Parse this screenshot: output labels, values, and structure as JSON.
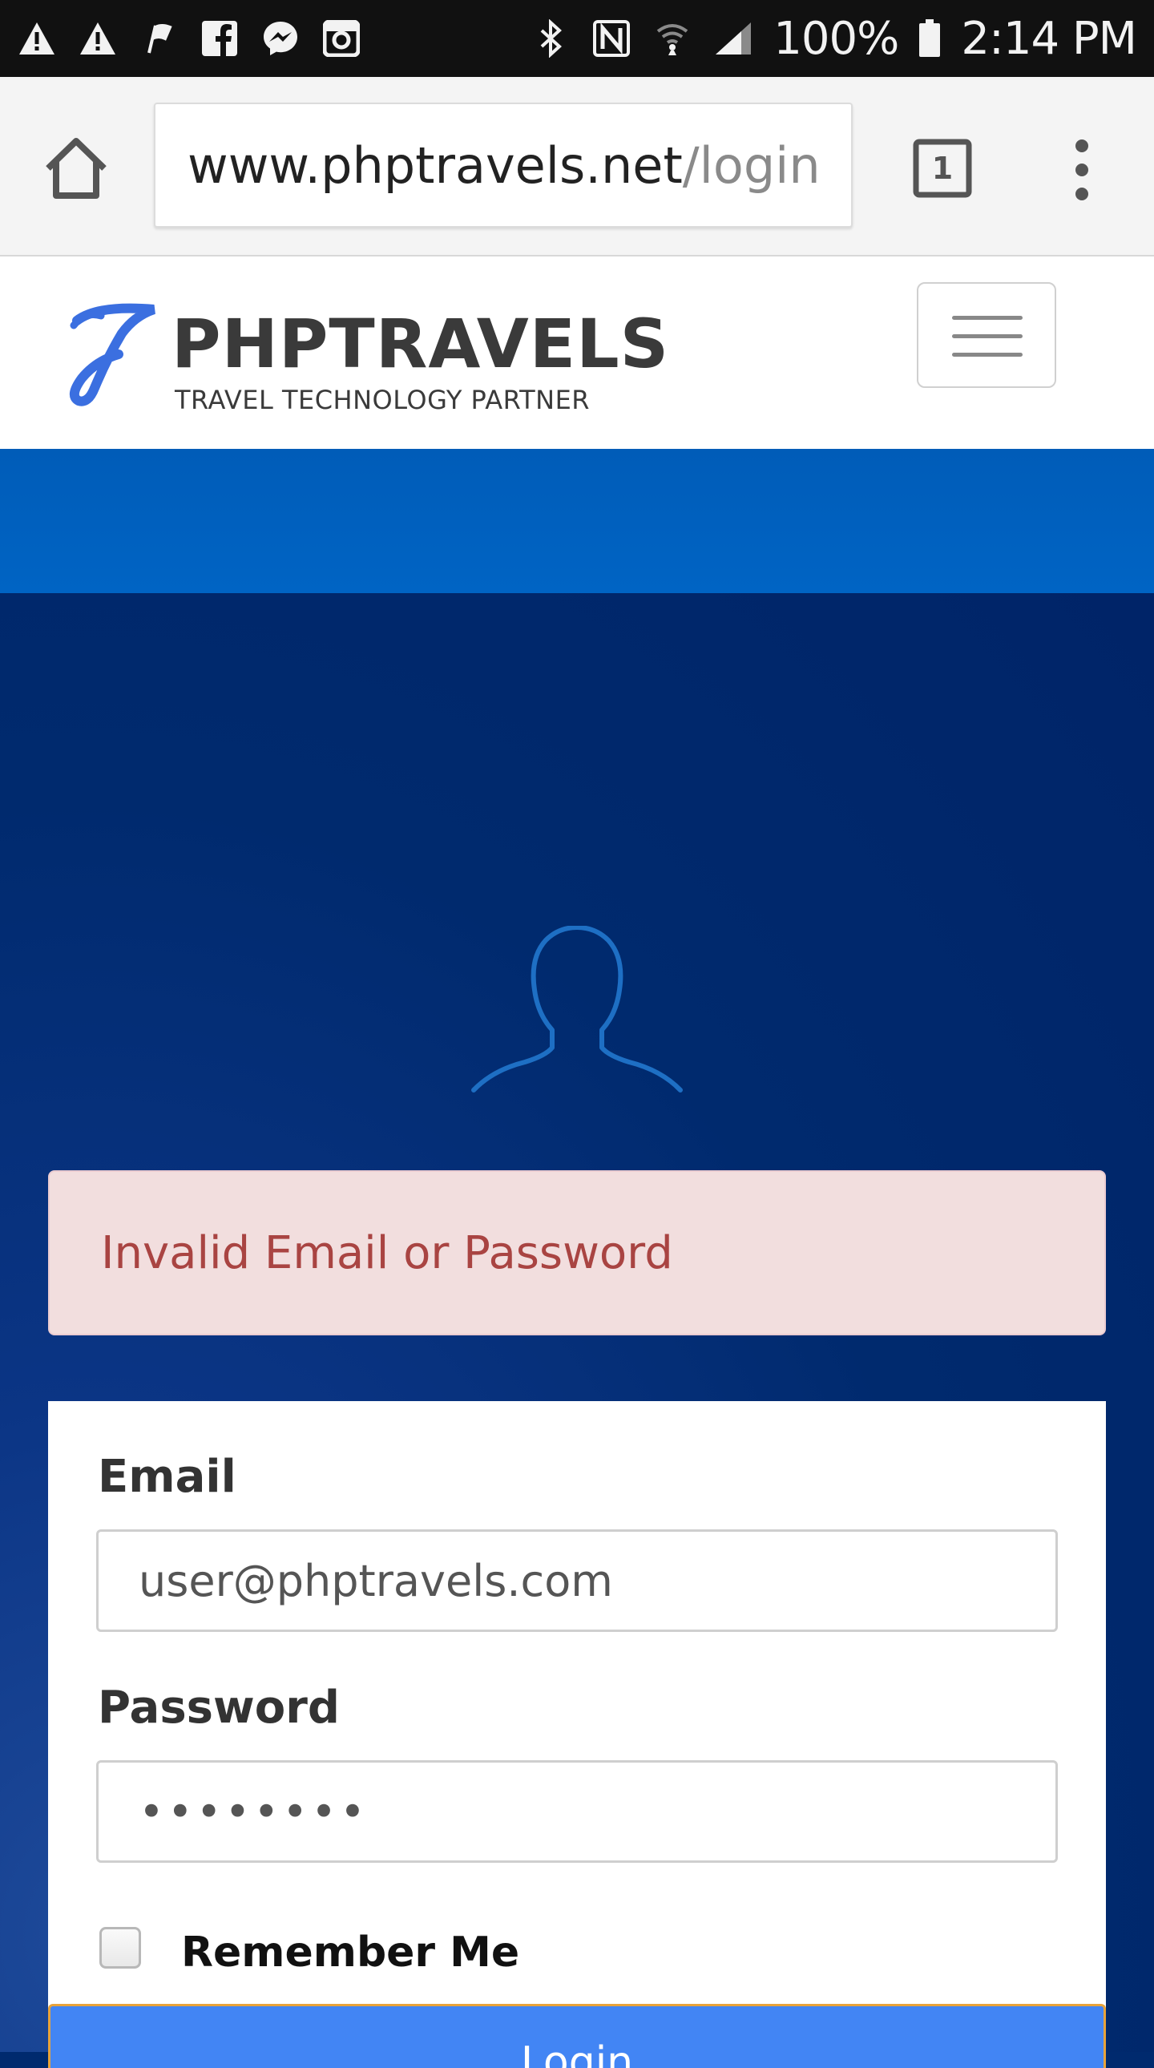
{
  "status_bar": {
    "battery": "100%",
    "time": "2:14 PM",
    "left_icons": [
      "warning-icon",
      "warning-icon",
      "flag-icon",
      "facebook-icon",
      "messenger-icon",
      "instagram-icon"
    ],
    "right_icons": [
      "bluetooth-icon",
      "nfc-icon",
      "wifi-icon",
      "signal-icon",
      "battery-icon"
    ]
  },
  "browser": {
    "url_domain": "www.phptravels.net",
    "url_path": "/login",
    "tab_count": "1"
  },
  "site": {
    "brand_name": "PHPTRAVELS",
    "tagline": "TRAVEL TECHNOLOGY PARTNER",
    "brand_color": "#3b6fe0"
  },
  "alert": {
    "message": "Invalid Email or Password",
    "color": "#a94442"
  },
  "login_form": {
    "email_label": "Email",
    "email_value": "user@phptravels.com",
    "password_label": "Password",
    "password_value": "••••••••",
    "remember_label": "Remember Me",
    "remember_checked": false,
    "login_button_label": "Login"
  },
  "colors": {
    "header_band": "#0060bf",
    "page_background": "#002a6e",
    "button": "#4285f4"
  }
}
